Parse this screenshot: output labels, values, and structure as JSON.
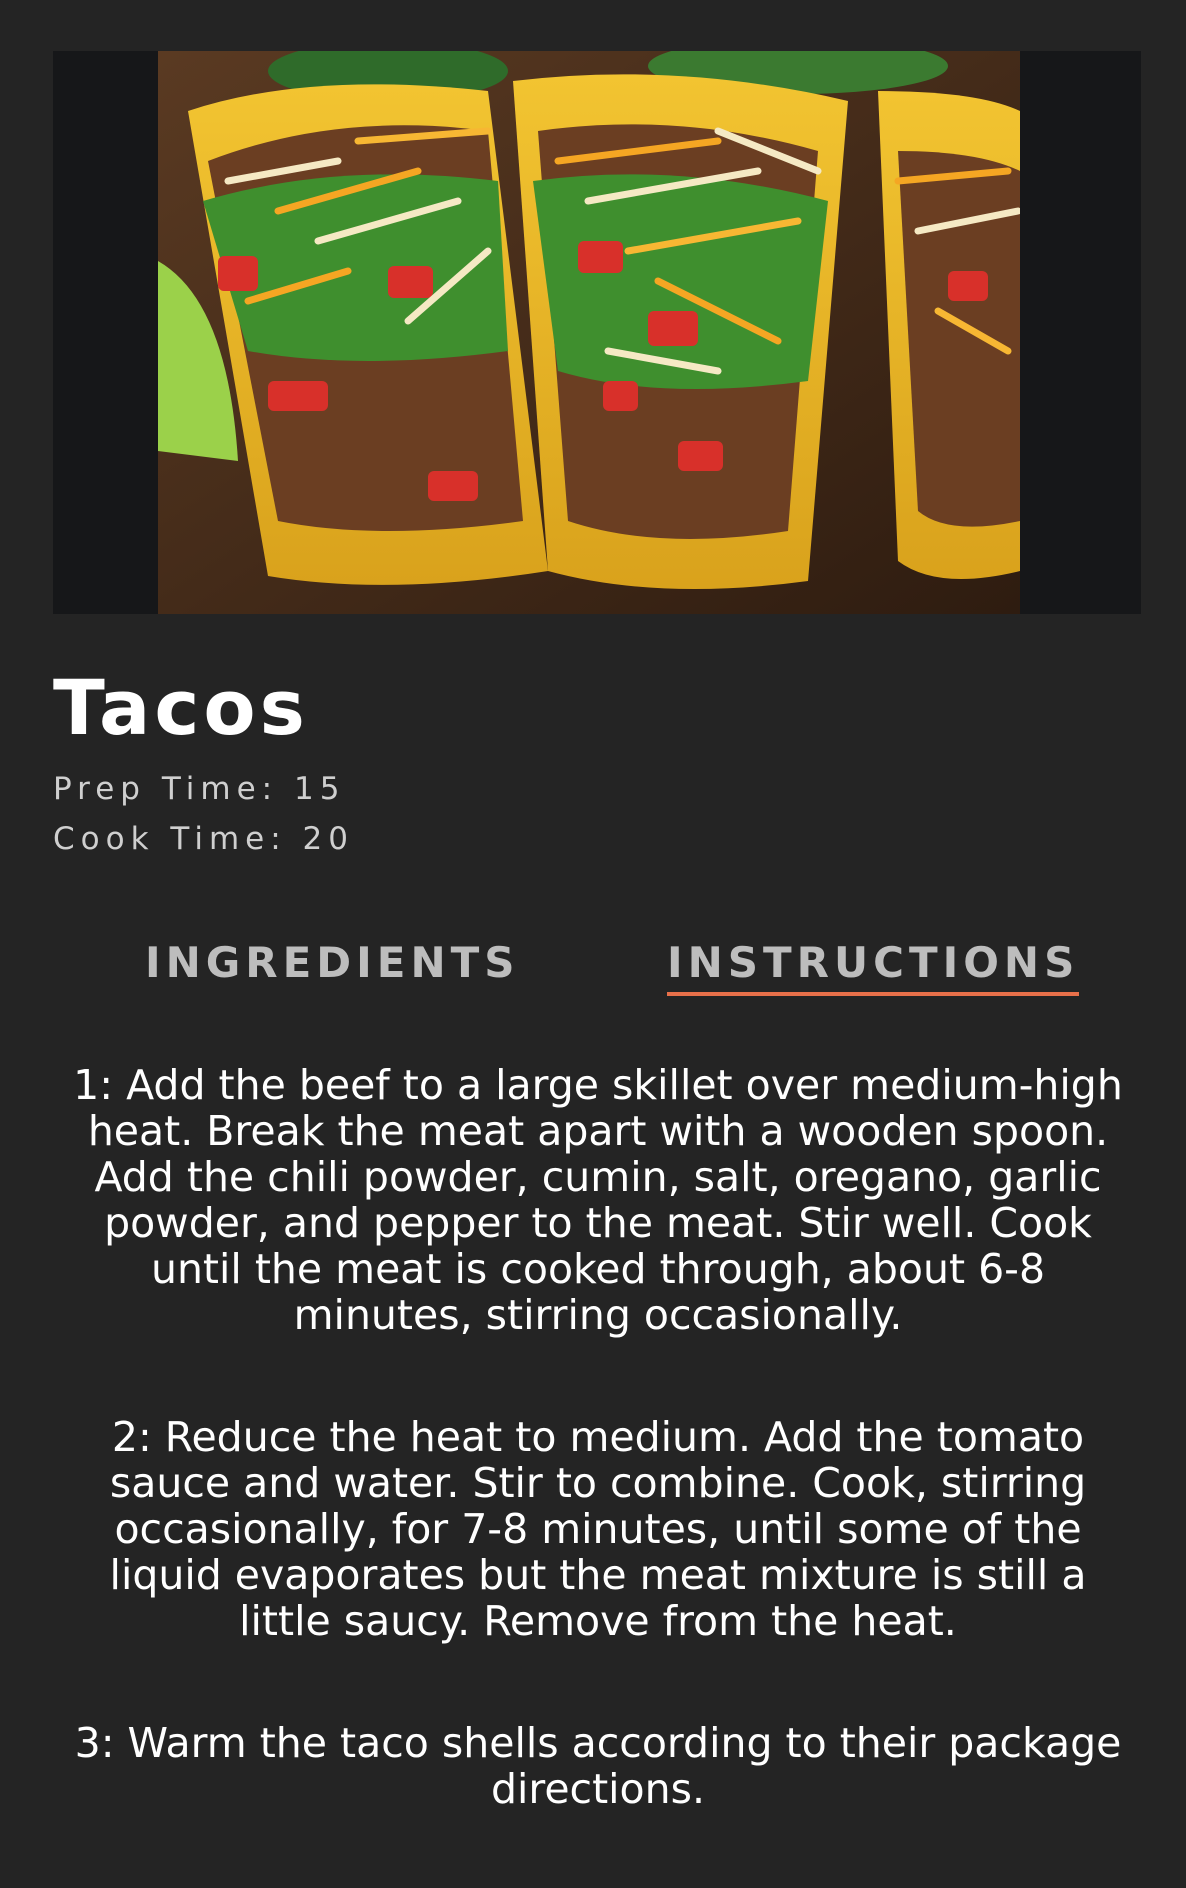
{
  "hero": {
    "image_alt": "Hard shell tacos filled with seasoned beef, lettuce, tomato and shredded cheese"
  },
  "recipe": {
    "title": "Tacos",
    "prep_time": "Prep Time: 15",
    "cook_time": "Cook Time: 20"
  },
  "tabs": {
    "ingredients": "INGREDIENTS",
    "instructions": "INSTRUCTIONS",
    "active": "instructions"
  },
  "instructions": [
    "1: Add the beef to a large skillet over medium-high heat. Break the meat apart with a wooden spoon. Add the chili powder, cumin, salt, oregano, garlic powder, and pepper to the meat. Stir well. Cook until the meat is cooked through, about 6-8 minutes, stirring occasionally.",
    "2: Reduce the heat to medium. Add the tomato sauce and water. Stir to combine. Cook, stirring occasionally, for 7-8 minutes, until some of the liquid evaporates but the meat mixture is still a little saucy. Remove from the heat.",
    "3: Warm the taco shells according to their package directions."
  ],
  "colors": {
    "background": "#242424",
    "tab_underline": "#e8704a",
    "tab_text": "#bdbdbd",
    "meta_text": "#cfcfcf"
  }
}
